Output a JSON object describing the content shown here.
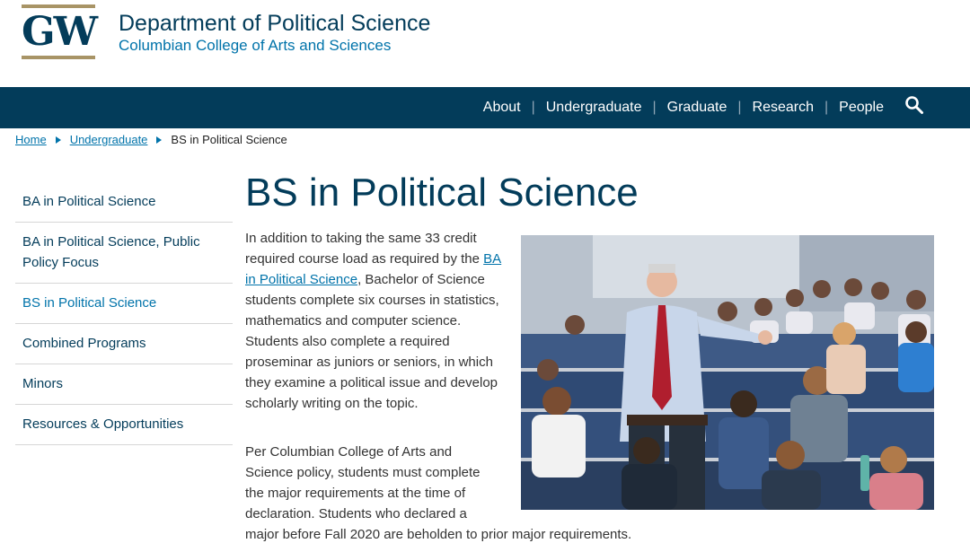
{
  "header": {
    "logo_text": "GW",
    "department": "Department of Political Science",
    "college": "Columbian College of Arts and Sciences"
  },
  "nav": {
    "items": [
      "About",
      "Undergraduate",
      "Graduate",
      "Research",
      "People"
    ],
    "search_icon": "search-icon"
  },
  "breadcrumb": {
    "home": "Home",
    "section": "Undergraduate",
    "current": "BS in Political Science"
  },
  "sidebar": {
    "items": [
      {
        "label": "BA in Political Science",
        "active": false
      },
      {
        "label": "BA in Political Science, Public Policy Focus",
        "active": false
      },
      {
        "label": "BS in Political Science",
        "active": true
      },
      {
        "label": "Combined Programs",
        "active": false
      },
      {
        "label": "Minors",
        "active": false
      },
      {
        "label": "Resources & Opportunities",
        "active": false
      }
    ]
  },
  "main": {
    "title": "BS in Political Science",
    "intro_before_link": "In addition to taking the same 33 credit required course load as required by the ",
    "intro_link": "BA in Political Science",
    "intro_after_link": ", Bachelor of Science students complete six courses in statistics, mathematics and computer science. Students also complete a required proseminar as juniors or seniors, in which they examine a political issue and develop scholarly writing on the topic.",
    "policy_lines": [
      "Per Columbian College of Arts and",
      "Science policy, students must complete",
      "the major requirements at the time of",
      "declaration. Students who declared a",
      "major before Fall 2020 are beholden to prior major requirements."
    ]
  },
  "colors": {
    "brand_navy": "#033c5a",
    "link_blue": "#0073aa",
    "gold": "#a89466"
  }
}
